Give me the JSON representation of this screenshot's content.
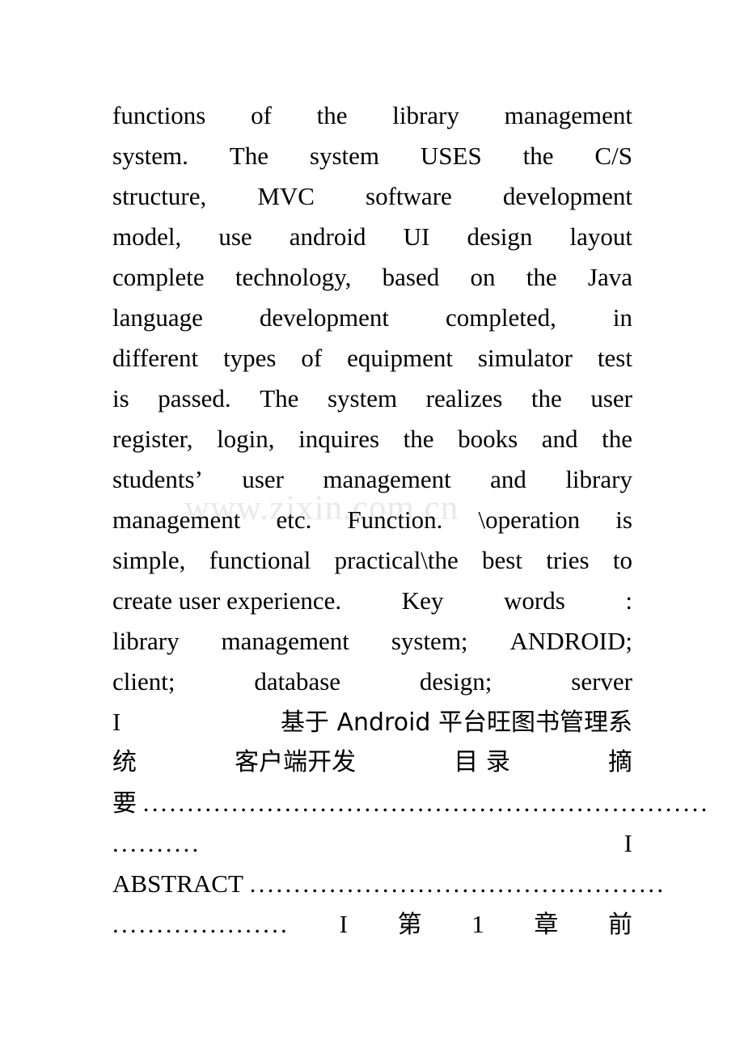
{
  "document": {
    "page_background": "#ffffff",
    "text_color": "#000000",
    "watermark": {
      "text": "www.zixin.com.cn",
      "color": "#e9e9e9"
    },
    "lines": [
      {
        "id": "l1",
        "mode": "justify",
        "words": [
          "functions",
          "of",
          "the",
          "library",
          "management"
        ]
      },
      {
        "id": "l2",
        "mode": "justify",
        "words": [
          "system.",
          "The",
          "system",
          "USES",
          "the",
          "C/S"
        ]
      },
      {
        "id": "l3",
        "mode": "justify",
        "words": [
          "structure,",
          "MVC",
          "software",
          "development"
        ]
      },
      {
        "id": "l4",
        "mode": "justify",
        "words": [
          "model,",
          "use",
          "android",
          "UI",
          "design",
          "layout"
        ]
      },
      {
        "id": "l5",
        "mode": "justify",
        "words": [
          "complete",
          "technology,",
          "based",
          "on",
          "the",
          "Java"
        ]
      },
      {
        "id": "l6",
        "mode": "justify",
        "words": [
          "language",
          "development",
          "completed,",
          "in"
        ]
      },
      {
        "id": "l7",
        "mode": "justify",
        "words": [
          "different",
          "types",
          "of",
          "equipment",
          "simulator",
          "test"
        ]
      },
      {
        "id": "l8",
        "mode": "justify",
        "words": [
          "is",
          "passed.",
          "The",
          "system",
          "realizes",
          "the",
          "user"
        ]
      },
      {
        "id": "l9",
        "mode": "justify",
        "words": [
          "register,",
          "login,",
          "inquires",
          "the",
          "books",
          "and",
          "the"
        ]
      },
      {
        "id": "l10",
        "mode": "justify",
        "words": [
          "students’",
          "user",
          "management",
          "and",
          "library"
        ]
      },
      {
        "id": "l11",
        "mode": "justify",
        "words": [
          "management",
          "etc.",
          "Function.",
          "\\operation",
          "is"
        ]
      },
      {
        "id": "l12",
        "mode": "justify",
        "words": [
          "simple,",
          "functional",
          "practical\\the",
          "best",
          "tries",
          "to"
        ]
      },
      {
        "id": "l13",
        "mode": "justify",
        "words": [
          "create user experience.",
          "Key",
          "words",
          ":"
        ]
      },
      {
        "id": "l14",
        "mode": "justify",
        "words": [
          "library",
          "management",
          "system;",
          "ANDROID;"
        ]
      },
      {
        "id": "l15",
        "mode": "justify",
        "words": [
          "client;",
          "database",
          "design;",
          "server"
        ]
      },
      {
        "id": "l16",
        "mode": "justify",
        "cjk": true,
        "words": [
          "I",
          "基于 Android 平台旺图书管理系"
        ]
      },
      {
        "id": "l17",
        "mode": "justify",
        "cjk": true,
        "words": [
          "统",
          "客户端开发",
          "目 录",
          "摘"
        ]
      },
      {
        "id": "l18",
        "mode": "flush",
        "cjk": true,
        "words": [
          "要",
          " ",
          "................................................................"
        ]
      },
      {
        "id": "l19",
        "mode": "justify",
        "words": [
          "..........",
          "I"
        ]
      },
      {
        "id": "l20",
        "mode": "flush",
        "words": [
          "ABSTRACT",
          " ",
          "..............................................."
        ]
      },
      {
        "id": "l21",
        "mode": "justify",
        "cjk_tail": true,
        "words": [
          "....................",
          "I",
          "第",
          "1",
          "章",
          "前"
        ]
      }
    ]
  }
}
